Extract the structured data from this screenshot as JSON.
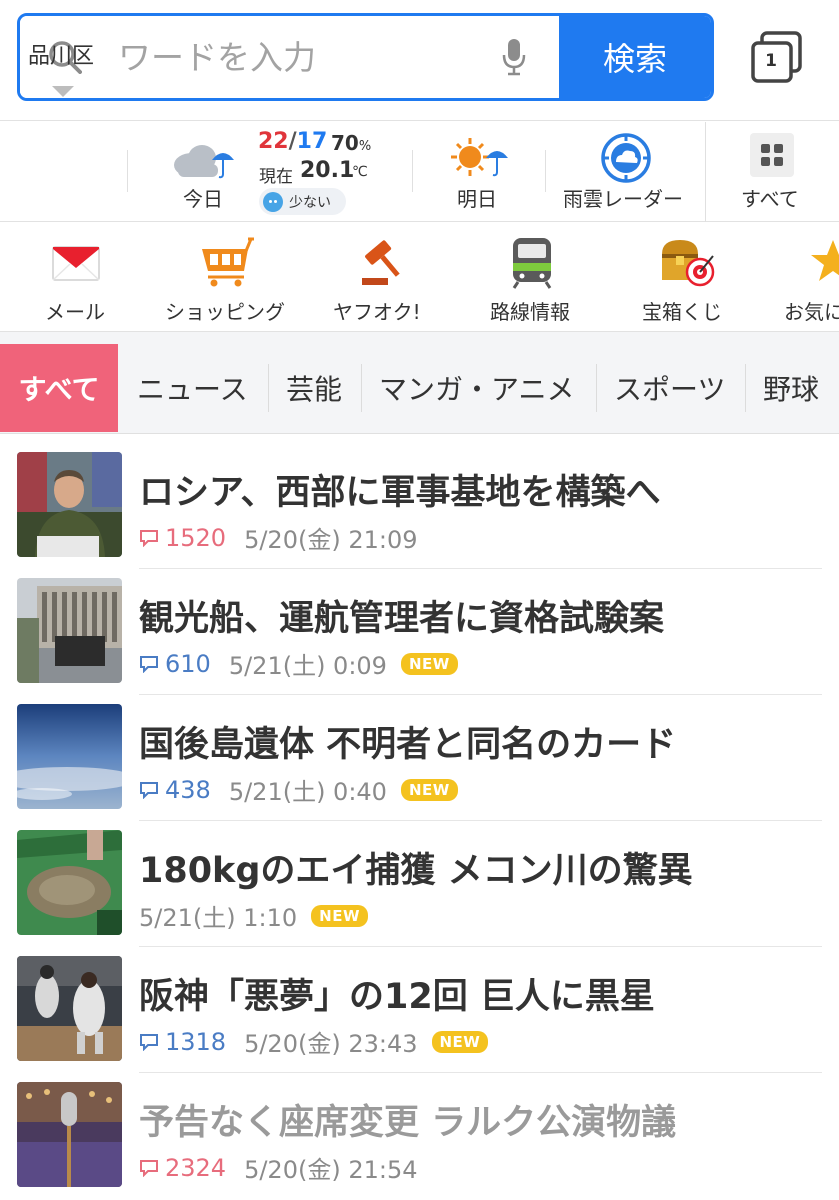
{
  "search": {
    "placeholder": "ワードを入力",
    "button_label": "検索",
    "tab_count": "1"
  },
  "weather": {
    "location": "品川区",
    "today_label": "今日",
    "high": "22",
    "sep": "/",
    "low": "17",
    "precip": "70",
    "precip_unit": "%",
    "now_label": "現在",
    "now_temp": "20.1",
    "now_unit": "℃",
    "pollen": "少ない",
    "tomorrow_label": "明日",
    "radar_label": "雨雲レーダー",
    "all_label": "すべて"
  },
  "shortcuts": [
    {
      "label": "メール",
      "icon": "mail-icon"
    },
    {
      "label": "ショッピング",
      "icon": "shopping-cart-icon"
    },
    {
      "label": "ヤフオク!",
      "icon": "auction-gavel-icon"
    },
    {
      "label": "路線情報",
      "icon": "train-icon"
    },
    {
      "label": "宝箱くじ",
      "icon": "treasure-box-icon"
    },
    {
      "label": "お気に",
      "icon": "star-icon"
    }
  ],
  "categories": [
    "すべて",
    "ニュース",
    "芸能",
    "マンガ・アニメ",
    "スポーツ",
    "野球"
  ],
  "news": [
    {
      "title": "ロシア、西部に軍事基地を構築へ",
      "comments": "1520",
      "date": "5/20(金) 21:09",
      "new": ""
    },
    {
      "title": "観光船、運航管理者に資格試験案",
      "comments": "610",
      "date": "5/21(土) 0:09",
      "new": "NEW"
    },
    {
      "title": "国後島遺体 不明者と同名のカード",
      "comments": "438",
      "date": "5/21(土) 0:40",
      "new": "NEW"
    },
    {
      "title": "180kgのエイ捕獲 メコン川の驚異",
      "comments": "",
      "date": "5/21(土) 1:10",
      "new": "NEW"
    },
    {
      "title": "阪神「悪夢」の12回 巨人に黒星",
      "comments": "1318",
      "date": "5/20(金) 23:43",
      "new": "NEW"
    },
    {
      "title": "予告なく座席変更 ラルク公演物議",
      "comments": "2324",
      "date": "5/20(金) 21:54",
      "new": ""
    }
  ],
  "colors": {
    "accent": "#1f7af0",
    "active_tab": "#f0637a",
    "new_badge": "#f4c21f",
    "hot_comments": "#e76c7c",
    "comments": "#4a7cc4"
  }
}
